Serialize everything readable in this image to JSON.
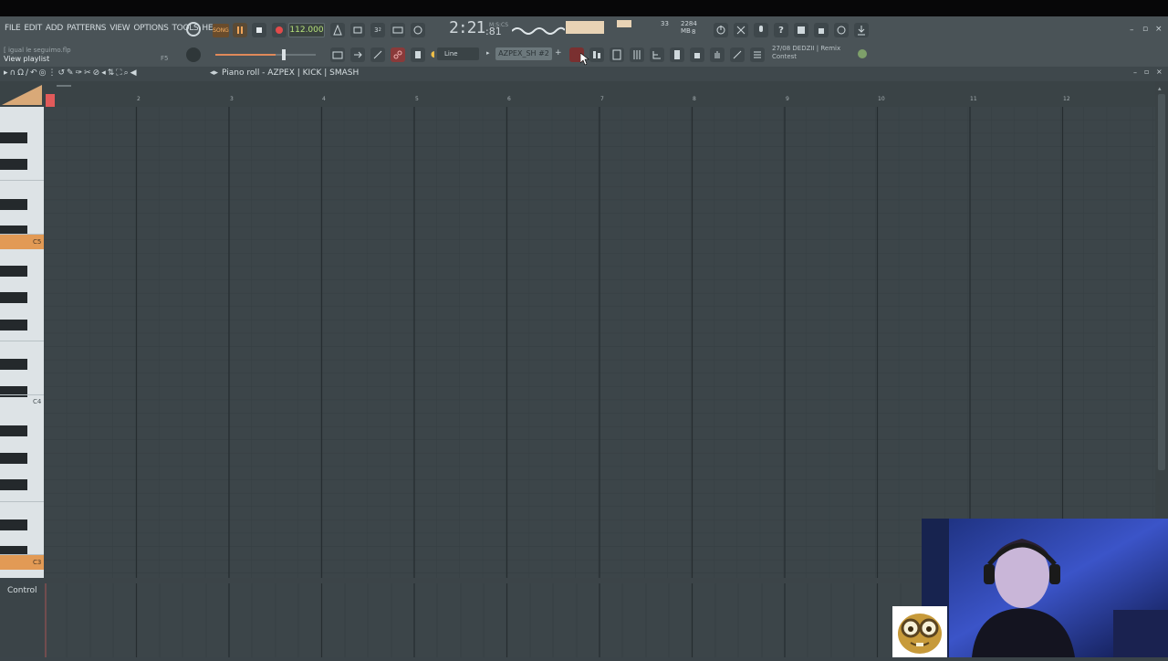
{
  "menu": [
    "FILE",
    "EDIT",
    "ADD",
    "PATTERNS",
    "VIEW",
    "OPTIONS",
    "TOOLS",
    "HELP"
  ],
  "transport": {
    "song_mode": "SONG",
    "tempo": "112.000",
    "time": "2:21",
    "time_unit": "M:S:CS",
    "time_frac": ":81"
  },
  "memory": {
    "cpu": "33",
    "ram": "2284 MB",
    "poly": "8"
  },
  "hint": {
    "title": "[ igual le seguimo.flp",
    "text": "View playlist",
    "key": "F5"
  },
  "snap": {
    "value": "Line"
  },
  "pattern": {
    "name": "AZPEX_SH #2"
  },
  "news": {
    "line1": "27/08  DEDZII | Remix",
    "line2": "Contest"
  },
  "piano_roll": {
    "title": "Piano roll - AZPEX | KICK | SMASH",
    "bars": [
      "2",
      "3",
      "4",
      "5",
      "6",
      "7",
      "8",
      "9",
      "10",
      "11",
      "12"
    ],
    "key_labels": {
      "c5": "C5",
      "c4": "C4",
      "c3": "C3"
    },
    "control_label": "Control"
  },
  "colors": {
    "accent": "#e29a55",
    "grid_bg": "#3b4449",
    "toolbar": "#4a5357",
    "tempo_text": "#b6e27a"
  }
}
